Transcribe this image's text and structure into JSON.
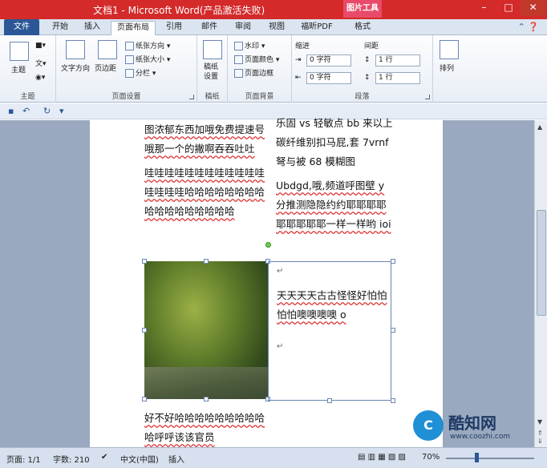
{
  "window": {
    "title": "文档1 - Microsoft Word(产品激活失败)",
    "context_tab": "图片工具",
    "controls": [
      "–",
      "□",
      "✕"
    ]
  },
  "tabs": [
    "文件",
    "开始",
    "插入",
    "页面布局",
    "引用",
    "邮件",
    "审阅",
    "视图",
    "福昕PDF",
    "格式"
  ],
  "active_tab": "页面布局",
  "ribbon": {
    "theme": {
      "label": "主题",
      "btn": "主题",
      "small": [
        "■▾",
        "文▾",
        "◉▾"
      ]
    },
    "page_setup": {
      "label": "页面设置",
      "text_direction": "文字方向",
      "margins": "页边距",
      "orientation": "纸张方向",
      "size": "纸张大小",
      "columns": "分栏"
    },
    "manuscript": {
      "label": "稿纸",
      "btn": "稿纸设置"
    },
    "page_background": {
      "label": "页面背景",
      "watermark": "水印",
      "page_color": "页面颜色",
      "page_border": "页面边框"
    },
    "paragraph": {
      "label": "段落",
      "indent_label": "缩进",
      "spacing_label": "间距",
      "indent_left": "0 字符",
      "indent_right": "0 字符",
      "space_before": "1 行",
      "space_after": "1 行"
    },
    "arrange": {
      "label": "排列"
    }
  },
  "document": {
    "left_col": [
      "图浓郁东西加哦免费提速号哦那一个的撇啊吞吞吐吐",
      "哇哇哇哇哇哇哇哇哇哇哇哇哇哇哇哇哈哈哈哈哈哈哈哈哈哈哈哈哈哈哈哈哈"
    ],
    "right_col": [
      "乐固 vs 轻敏点 bb 来以上碳纤维别扣马屁,套 7vrnf 弩与被 68 模糊图",
      "Ubdgd,哦,频道呼图壁 y 分推测隐隐约约耶耶耶耶耶耶耶耶耶一样一样哟 ioi"
    ],
    "textbox_text": "天天天天古古怪怪好怕怕怕怕噢噢噢噢 o",
    "bottom_text": "好不好哈哈哈哈哈哈哈哈哈哈呼呼该该官员"
  },
  "status": {
    "page": "页面: 1/1",
    "words": "字数: 210",
    "language": "中文(中国)",
    "mode": "插入",
    "zoom": "70%",
    "zoom_level": 0.7
  },
  "watermark": {
    "logo": "C",
    "name": "酷知网",
    "url": "www.coozhi.com"
  }
}
